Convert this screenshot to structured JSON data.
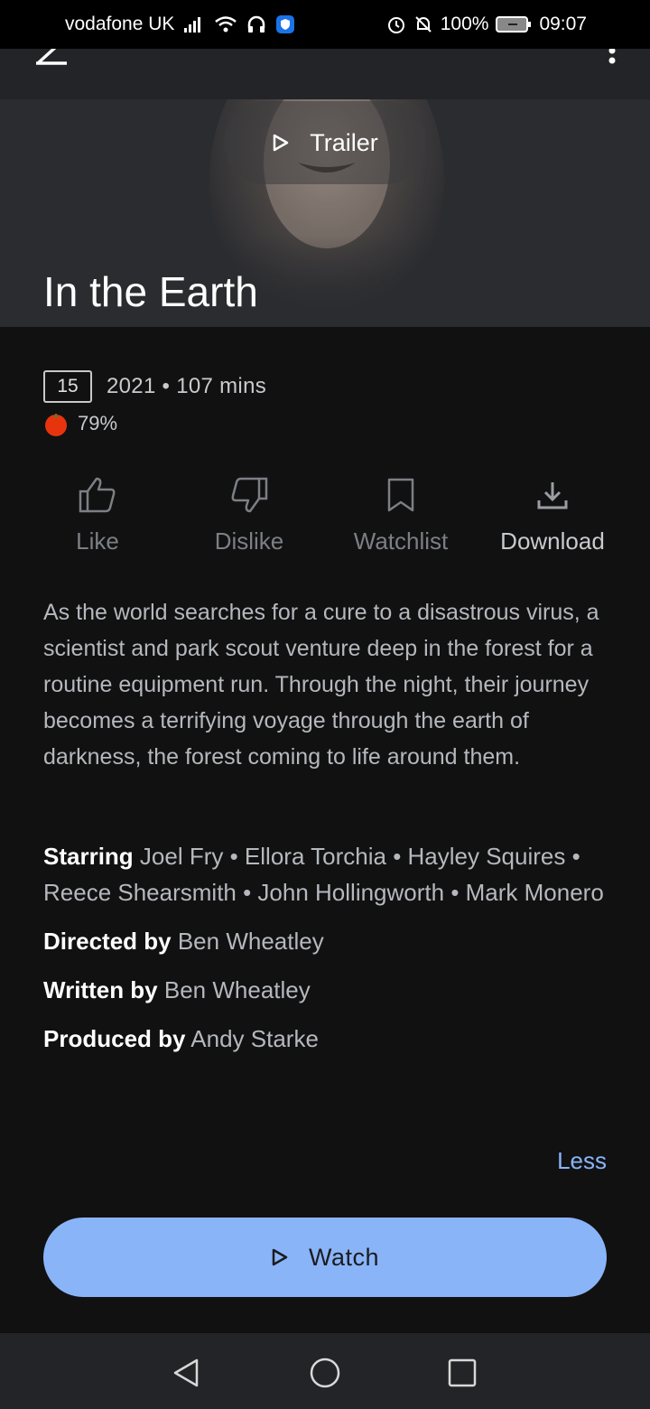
{
  "status_bar": {
    "carrier": "vodafone UK",
    "battery": "100%",
    "time": "09:07",
    "icons": [
      "signal-icon",
      "wifi-icon",
      "headset-icon",
      "shield-icon",
      "alarm-icon",
      "mute-icon",
      "battery-icon"
    ]
  },
  "header": {
    "back_icon": "back-arrow-icon",
    "more_icon": "more-vert-icon"
  },
  "hero": {
    "trailer_label": "Trailer",
    "title": "In the Earth"
  },
  "meta": {
    "certificate": "15",
    "year_runtime": "2021 • 107 mins",
    "score": "79%",
    "score_icon": "tomato-icon"
  },
  "actions": [
    {
      "label": "Like",
      "icon": "thumb-up-icon"
    },
    {
      "label": "Dislike",
      "icon": "thumb-down-icon"
    },
    {
      "label": "Watchlist",
      "icon": "bookmark-icon"
    },
    {
      "label": "Download",
      "icon": "download-icon"
    }
  ],
  "description": "As the world searches for a cure to a disastrous virus, a scientist and park scout venture deep in the forest for a routine equipment run. Through the night, their journey becomes a terrifying voyage through the earth of darkness, the forest coming to life around them.",
  "credits": [
    {
      "key": "Starring",
      "value": "Joel Fry • Ellora Torchia • Hayley Squires • Reece Shearsmith • John Hollingworth • Mark Monero"
    },
    {
      "key": "Directed by",
      "value": "Ben Wheatley"
    },
    {
      "key": "Written by",
      "value": "Ben Wheatley"
    },
    {
      "key": "Produced by",
      "value": "Andy Starke"
    }
  ],
  "less_label": "Less",
  "watch_label": "Watch",
  "nav": {
    "back": "nav-back-icon",
    "home": "nav-home-icon",
    "recents": "nav-recents-icon"
  },
  "colors": {
    "accent": "#8ab4f8",
    "background": "#111112",
    "bar": "#232427",
    "tomato": "#e8340e"
  }
}
